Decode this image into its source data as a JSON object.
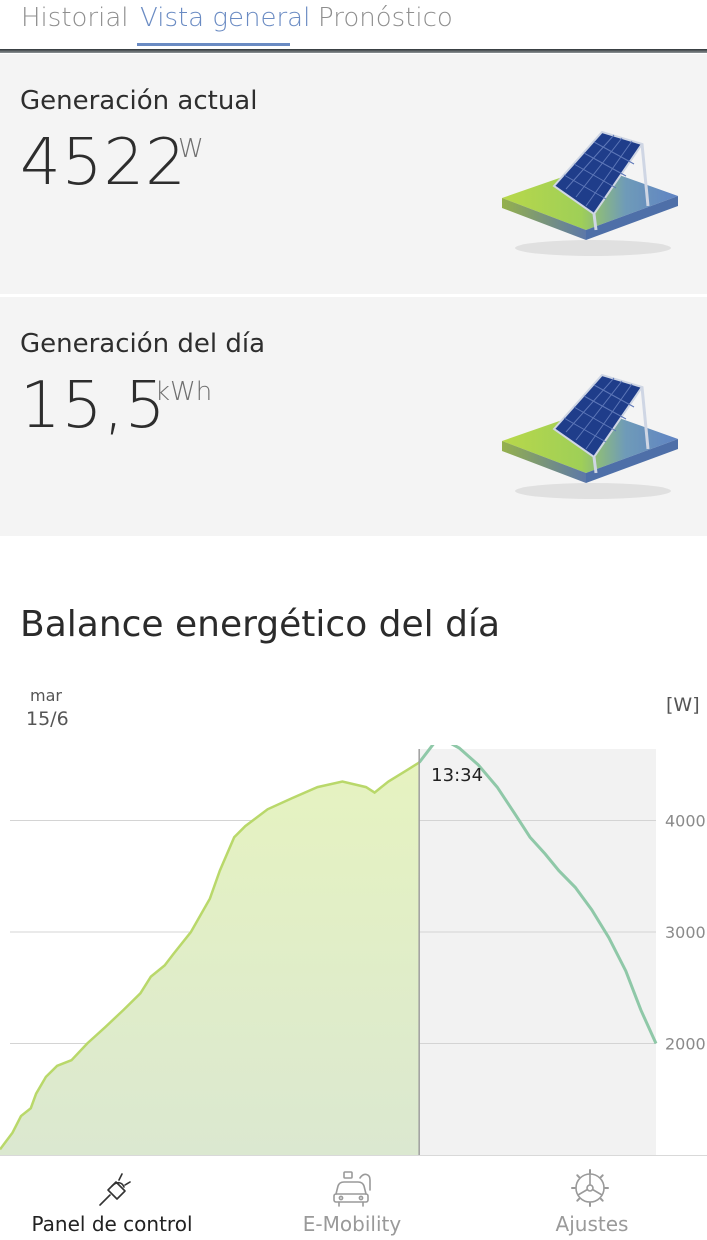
{
  "tabs": [
    {
      "label": "Historial"
    },
    {
      "label": "Vista general"
    },
    {
      "label": "Pronóstico"
    }
  ],
  "current_generation": {
    "title": "Generación actual",
    "value": "4522",
    "unit": "W"
  },
  "daily_generation": {
    "title": "Generación del día",
    "value": "15,5",
    "unit": "kWh"
  },
  "balance": {
    "title": "Balance energético del día",
    "day": "mar",
    "date": "15/6",
    "unit": "[W]"
  },
  "colors": {
    "accent": "#6a8bc3",
    "production_fill_top": "#e6f3c0",
    "production_fill_bottom": "#dbe8d0",
    "production_line": "#b9d86a",
    "forecast_line": "#8fc8a8",
    "now_line": "#9e9e9e"
  },
  "chart_data": {
    "type": "area",
    "ylabel": "[W]",
    "y_ticks": [
      "4000",
      "3000",
      "2000"
    ],
    "y_tick_values": [
      4000,
      3000,
      2000
    ],
    "ylim": [
      1000,
      4750
    ],
    "grid": true,
    "cursor_label": "13:34",
    "xlim": [
      0.0,
      1.0
    ],
    "cursor_x": 0.639,
    "series": [
      {
        "x": [
          0.0,
          0.019,
          0.032,
          0.047,
          0.055,
          0.07,
          0.087,
          0.109,
          0.133,
          0.161,
          0.188,
          0.214,
          0.23,
          0.251,
          0.264,
          0.291,
          0.32,
          0.335,
          0.357,
          0.374,
          0.408,
          0.445,
          0.484,
          0.522,
          0.558,
          0.571,
          0.592,
          0.62,
          0.639
        ],
        "y": [
          1050,
          1200,
          1350,
          1420,
          1550,
          1700,
          1800,
          1850,
          2000,
          2150,
          2300,
          2450,
          2600,
          2700,
          2800,
          3000,
          3300,
          3550,
          3850,
          3950,
          4100,
          4200,
          4300,
          4350,
          4300,
          4250,
          4350,
          4450,
          4520
        ]
      },
      {
        "x": [
          0.639,
          0.669,
          0.7,
          0.729,
          0.758,
          0.786,
          0.808,
          0.831,
          0.852,
          0.877,
          0.902,
          0.928,
          0.954,
          0.977,
          1.0
        ],
        "y": [
          4520,
          4750,
          4650,
          4500,
          4300,
          4050,
          3850,
          3700,
          3550,
          3400,
          3200,
          2950,
          2650,
          2300,
          2000
        ]
      }
    ]
  },
  "bottom_nav": [
    {
      "label": "Panel de control",
      "icon": "plug-icon"
    },
    {
      "label": "E-Mobility",
      "icon": "car-charging-icon"
    },
    {
      "label": "Ajustes",
      "icon": "settings-wheel-icon"
    }
  ]
}
